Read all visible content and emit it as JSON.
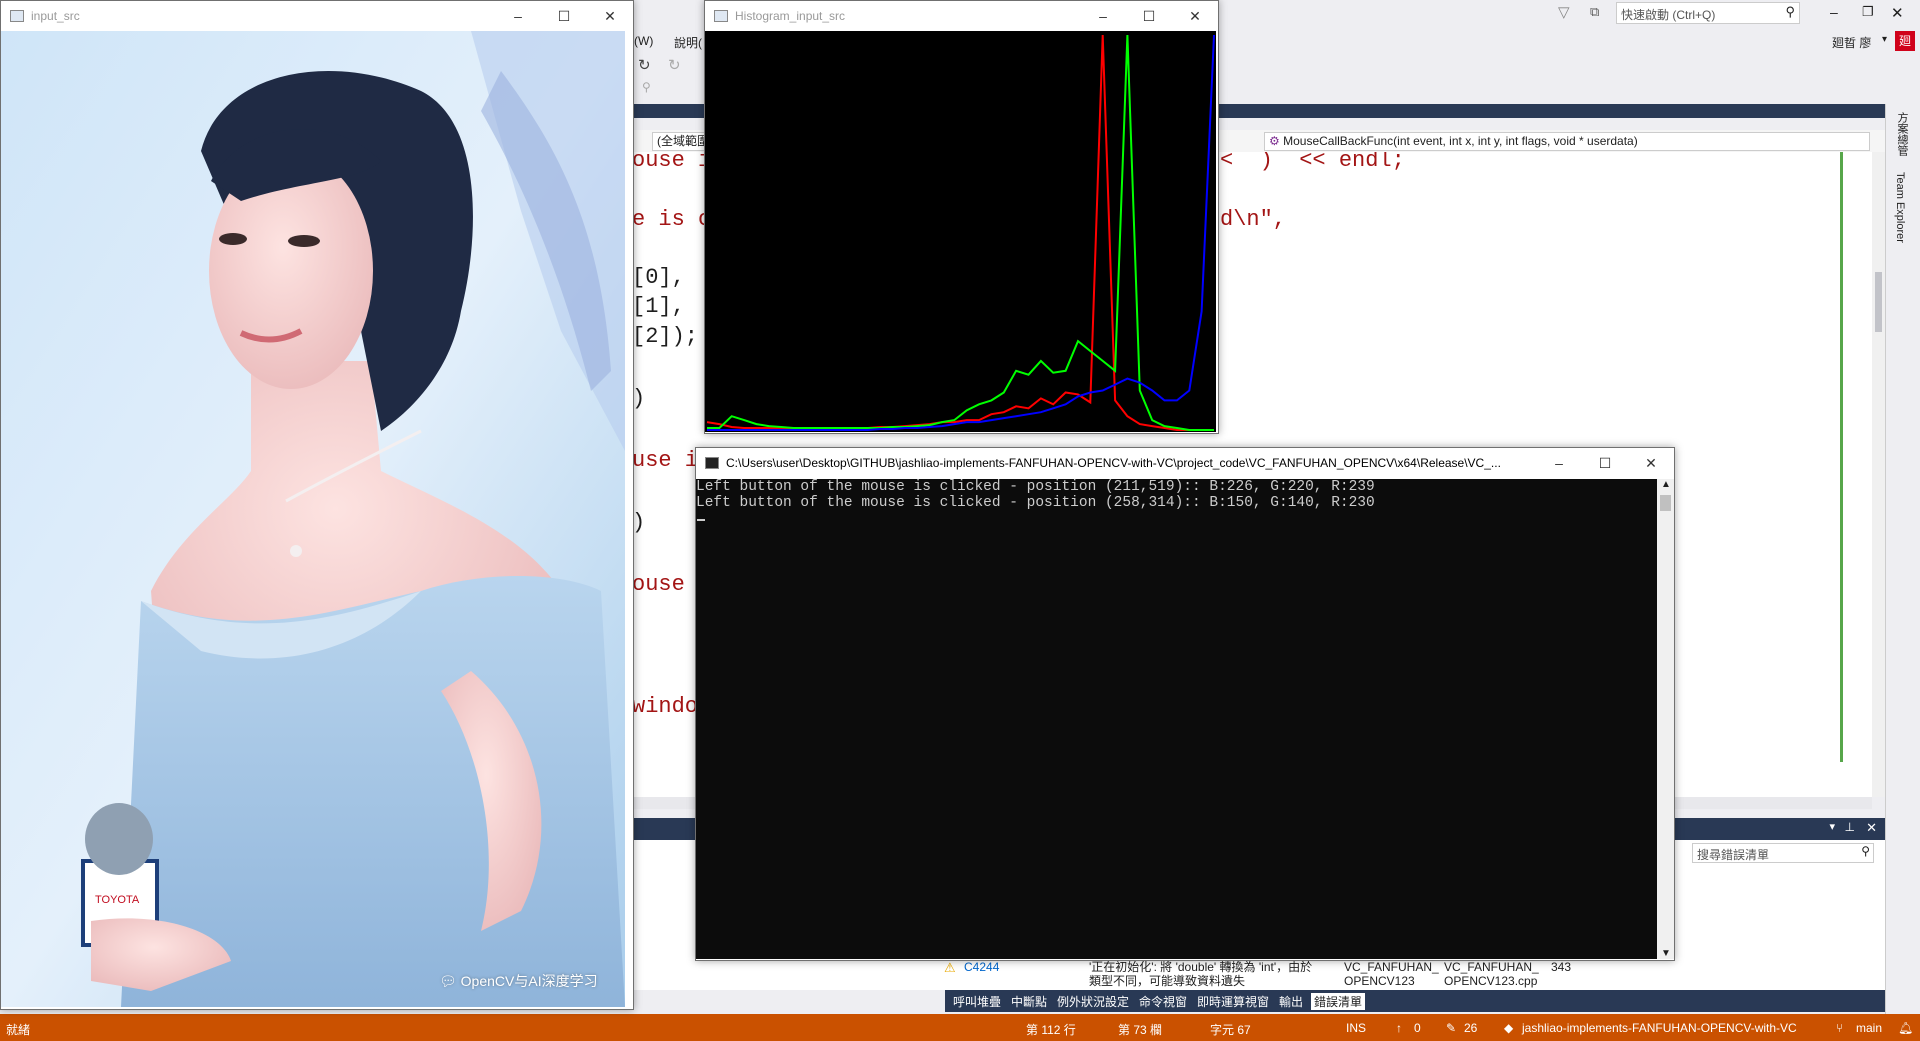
{
  "vs": {
    "menu_fragment_w": "(W)",
    "menu_fragment_help": "說明(",
    "quick_launch_placeholder": "快速啟動 (Ctrl+Q)",
    "account_name": "廻晢 廖",
    "account_avatar": "廻",
    "scope_combo": "(全域範圍",
    "member_combo": "MouseCallBackFunc(int event, int x, int y, int flags, void * userdata)",
    "side_tab_solution": "方案總管",
    "side_tab_team": "Team Explorer",
    "code_lines": [
      {
        "text": "ouse i",
        "right": "<  )  << endl;"
      },
      {
        "text": "e is c",
        "right": "d\\n\","
      },
      {
        "text": "[0],"
      },
      {
        "text": "[1],"
      },
      {
        "text": "[2]);"
      },
      {
        "text": ")"
      },
      {
        "text": "use is"
      },
      {
        "text": ")"
      },
      {
        "text": "ouse i"
      },
      {
        "text": "window"
      }
    ],
    "error_search_placeholder": "搜尋錯誤清單",
    "error_row": {
      "code": "C4244",
      "description": "'正在初始化': 將 'double' 轉換為 'int'，由於類型不同，可能導致資料遺失",
      "project": "VC_FANFUHAN_OPENCV123",
      "file": "VC_FANFUHAN_OPENCV123.cpp",
      "line": "343"
    },
    "bottom_tabs": [
      "呼叫堆疊",
      "中斷點",
      "例外狀況設定",
      "命令視窗",
      "即時運算視窗",
      "輸出",
      "錯誤清單"
    ],
    "status": {
      "ready": "就緒",
      "line": "第 112 行",
      "col": "第 73 欄",
      "char": "字元 67",
      "mode": "INS",
      "up_count": "0",
      "edit_count": "26",
      "repo": "jashliao-implements-FANFUHAN-OPENCV-with-VC",
      "branch": "main"
    }
  },
  "input_window": {
    "title": "input_src",
    "watermark": "OpenCV与AI深度学习",
    "mic_brand": "TOYOTA"
  },
  "hist_window": {
    "title": "Histogram_input_src"
  },
  "console_window": {
    "title": "C:\\Users\\user\\Desktop\\GITHUB\\jashliao-implements-FANFUHAN-OPENCV-with-VC\\project_code\\VC_FANFUHAN_OPENCV\\x64\\Release\\VC_...",
    "lines": [
      "Left button of the mouse is clicked - position (211,519):: B:226, G:220, R:239",
      "Left button of the mouse is clicked - position (258,314):: B:150, G:140, R:230"
    ]
  },
  "chart_data": {
    "type": "line",
    "series": [
      {
        "color": "#ff0000",
        "values": [
          8,
          6,
          3,
          2,
          2,
          2,
          2,
          2,
          2,
          2,
          2,
          2,
          2,
          2,
          3,
          3,
          4,
          5,
          6,
          8,
          8,
          10,
          10,
          16,
          18,
          24,
          22,
          32,
          26,
          38,
          36,
          28,
          420,
          30,
          14,
          6,
          4,
          2,
          0,
          0,
          0,
          0
        ]
      },
      {
        "color": "#00ff00",
        "values": [
          2,
          2,
          14,
          10,
          6,
          4,
          3,
          2,
          2,
          2,
          2,
          2,
          2,
          2,
          2,
          3,
          3,
          4,
          5,
          8,
          10,
          20,
          26,
          30,
          38,
          60,
          56,
          70,
          58,
          60,
          90,
          80,
          70,
          60,
          400,
          40,
          10,
          4,
          2,
          0,
          0,
          0
        ]
      },
      {
        "color": "#0000ff",
        "values": [
          0,
          0,
          0,
          0,
          0,
          0,
          0,
          0,
          0,
          0,
          0,
          0,
          0,
          0,
          1,
          1,
          2,
          2,
          3,
          4,
          6,
          8,
          8,
          10,
          12,
          14,
          16,
          18,
          22,
          26,
          34,
          38,
          40,
          46,
          52,
          48,
          40,
          30,
          30,
          40,
          120,
          400
        ]
      }
    ]
  }
}
